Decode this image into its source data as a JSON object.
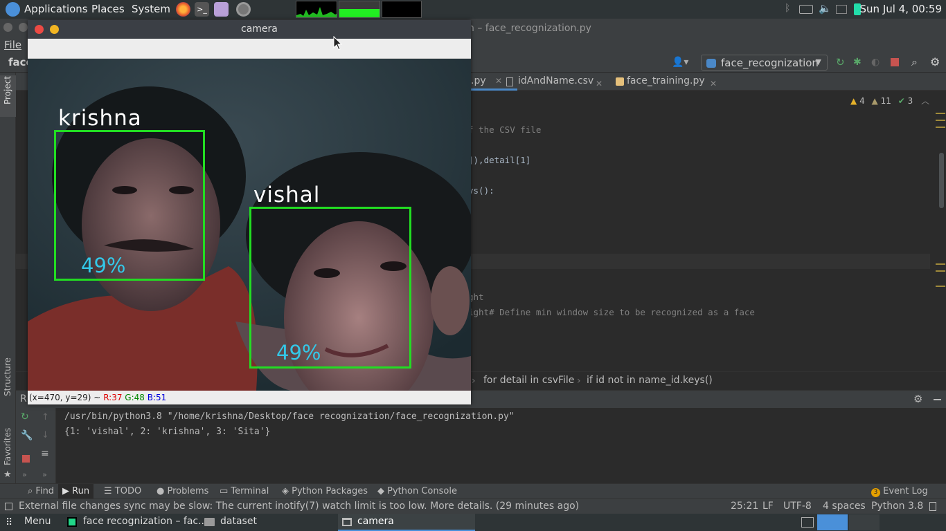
{
  "top_panel": {
    "applications": "Applications",
    "places": "Places",
    "system": "System",
    "clock": "Sun Jul 4, 00:59"
  },
  "ide": {
    "title_suffix": "n – face_recognization.py",
    "menu_file": "File",
    "project_short": "face",
    "run_config": "face_recognization",
    "tabs": {
      "active_partial": ".py",
      "tab2": "idAndName.csv",
      "tab3": "face_training.py"
    },
    "inspections": {
      "warnings": "4",
      "weak_warnings": "11",
      "ok": "3"
    },
    "code": {
      "line1": "f the CSV file",
      "line2": "]),detail[1]",
      "line3": "ys():",
      "line4": "ght",
      "line5": "ight# Define min window size to be recognized as a face"
    },
    "breadcrumbs": {
      "b1": "for detail in csvFile",
      "b2": "if id not in name_id.keys()"
    },
    "run_label": "R",
    "console": {
      "line1": "/usr/bin/python3.8 \"/home/krishna/Desktop/face recognization/face_recognization.py\"",
      "line2": "{1: 'vishal', 2: 'krishna', 3: 'Sita'}"
    },
    "left_labels": {
      "project": "Project",
      "structure": "Structure",
      "favorites": "Favorites"
    },
    "tool_tabs": {
      "find": "Find",
      "run": "Run",
      "todo": "TODO",
      "problems": "Problems",
      "terminal": "Terminal",
      "python_packages": "Python Packages",
      "python_console": "Python Console",
      "event_log": "Event Log",
      "event_count": "3"
    },
    "status": {
      "message": "External file changes sync may be slow: The current inotify(7) watch limit is too low. More details. (29 minutes ago)",
      "position": "25:21",
      "line_sep": "LF",
      "encoding": "UTF-8",
      "indent": "4 spaces",
      "interpreter": "Python 3.8"
    }
  },
  "camera": {
    "title": "camera",
    "faces": [
      {
        "name": "krishna",
        "confidence": "49%"
      },
      {
        "name": "vishal",
        "confidence": "49%"
      }
    ],
    "status": {
      "coords": "(x=470, y=29) ~",
      "r": "R:37",
      "g": "G:48",
      "b": "B:51"
    }
  },
  "bottom_panel": {
    "menu": "Menu",
    "task1": "face recognization – fac...",
    "task2": "dataset",
    "task3": "camera"
  },
  "colors": {
    "box_green": "#22dd22",
    "confidence_cyan": "#33c8e8",
    "panel_bg": "#2e3436",
    "ide_bg": "#2b2b2b"
  }
}
